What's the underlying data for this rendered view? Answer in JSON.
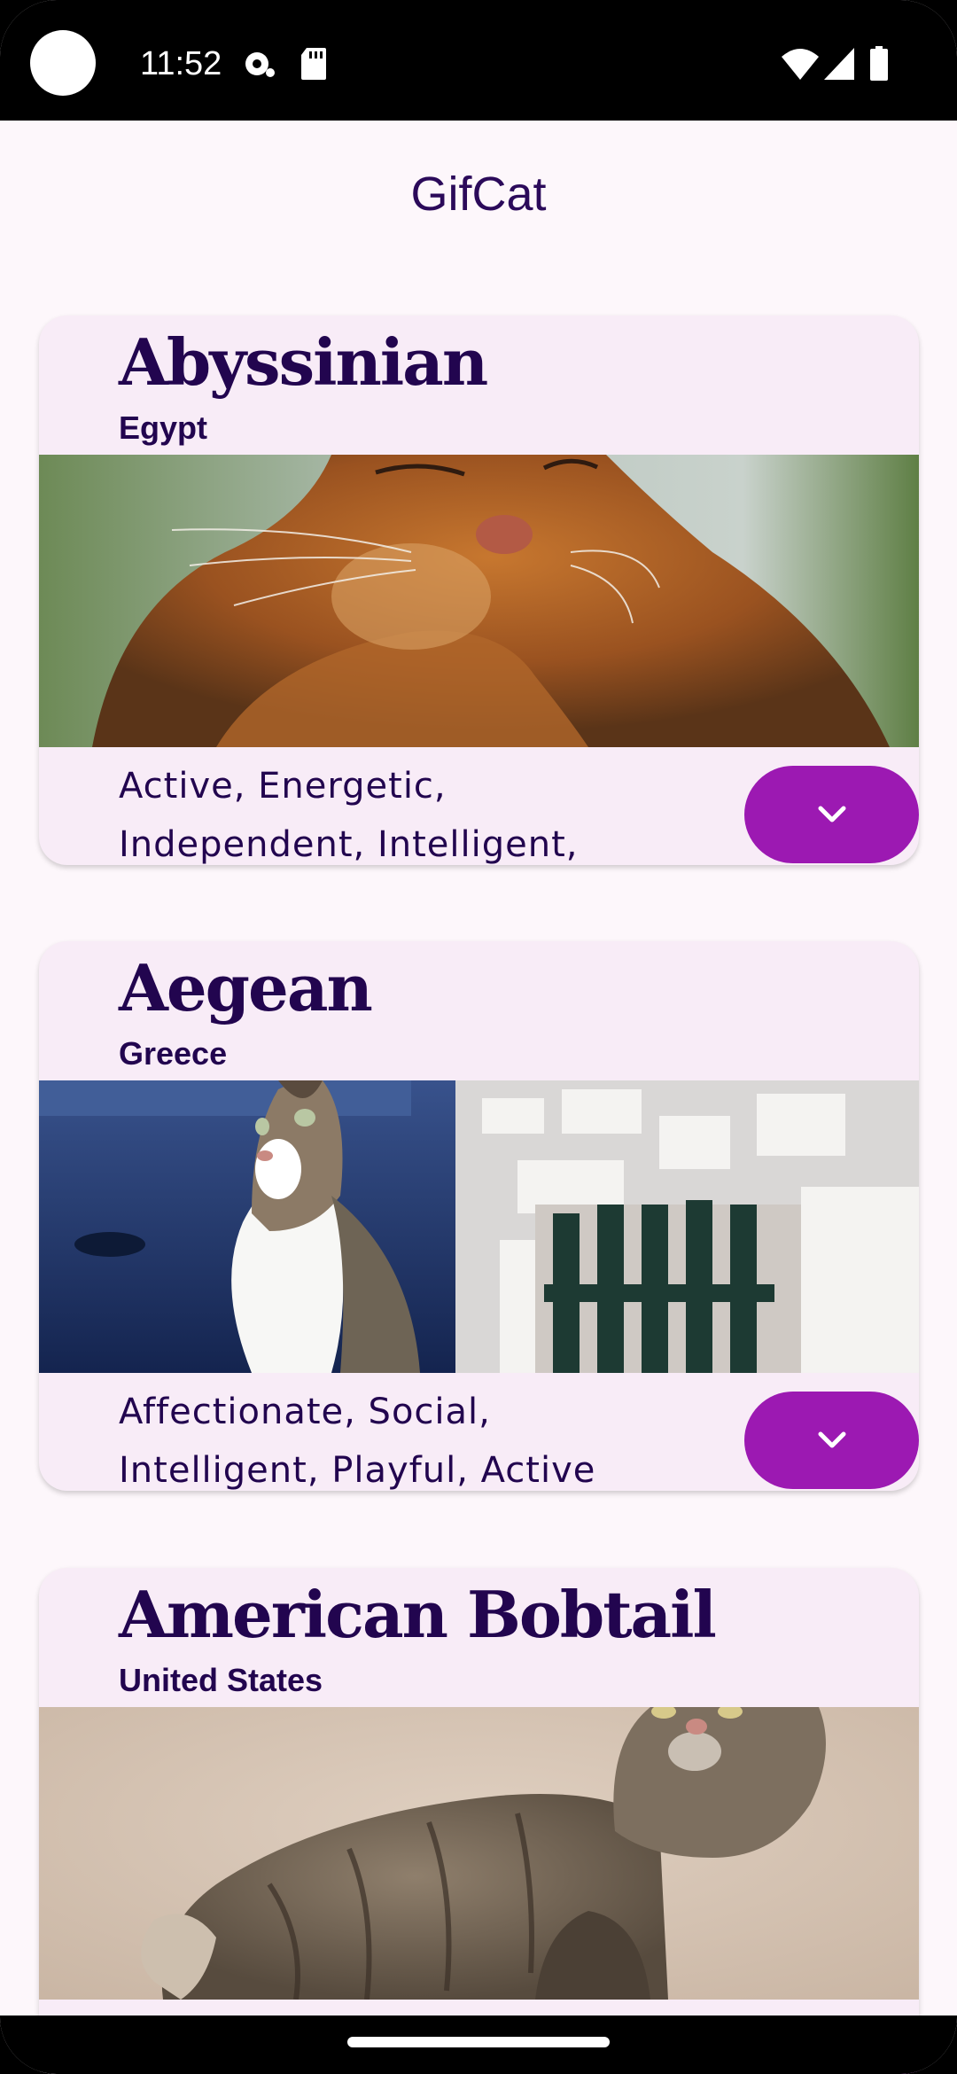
{
  "status_bar": {
    "time": "11:52",
    "left_icons": [
      "camera-dot",
      "sync-icon",
      "sd-card-icon"
    ],
    "right_icons": [
      "wifi-icon",
      "cell-signal-icon",
      "battery-icon"
    ]
  },
  "app": {
    "title": "GifCat"
  },
  "breeds": [
    {
      "name": "Abyssinian",
      "origin": "Egypt",
      "temperament": "Active, Energetic, Independent, Intelligent,"
    },
    {
      "name": "Aegean",
      "origin": "Greece",
      "temperament": "Affectionate, Social, Intelligent, Playful, Active"
    },
    {
      "name": "American Bobtail",
      "origin": "United States",
      "temperament": ""
    }
  ],
  "colors": {
    "background": "#fdf7fb",
    "card": "#f8ecf7",
    "text": "#22054f",
    "accent_button": "#9c19b2"
  },
  "icons": {
    "expand": "chevron-down-icon"
  }
}
